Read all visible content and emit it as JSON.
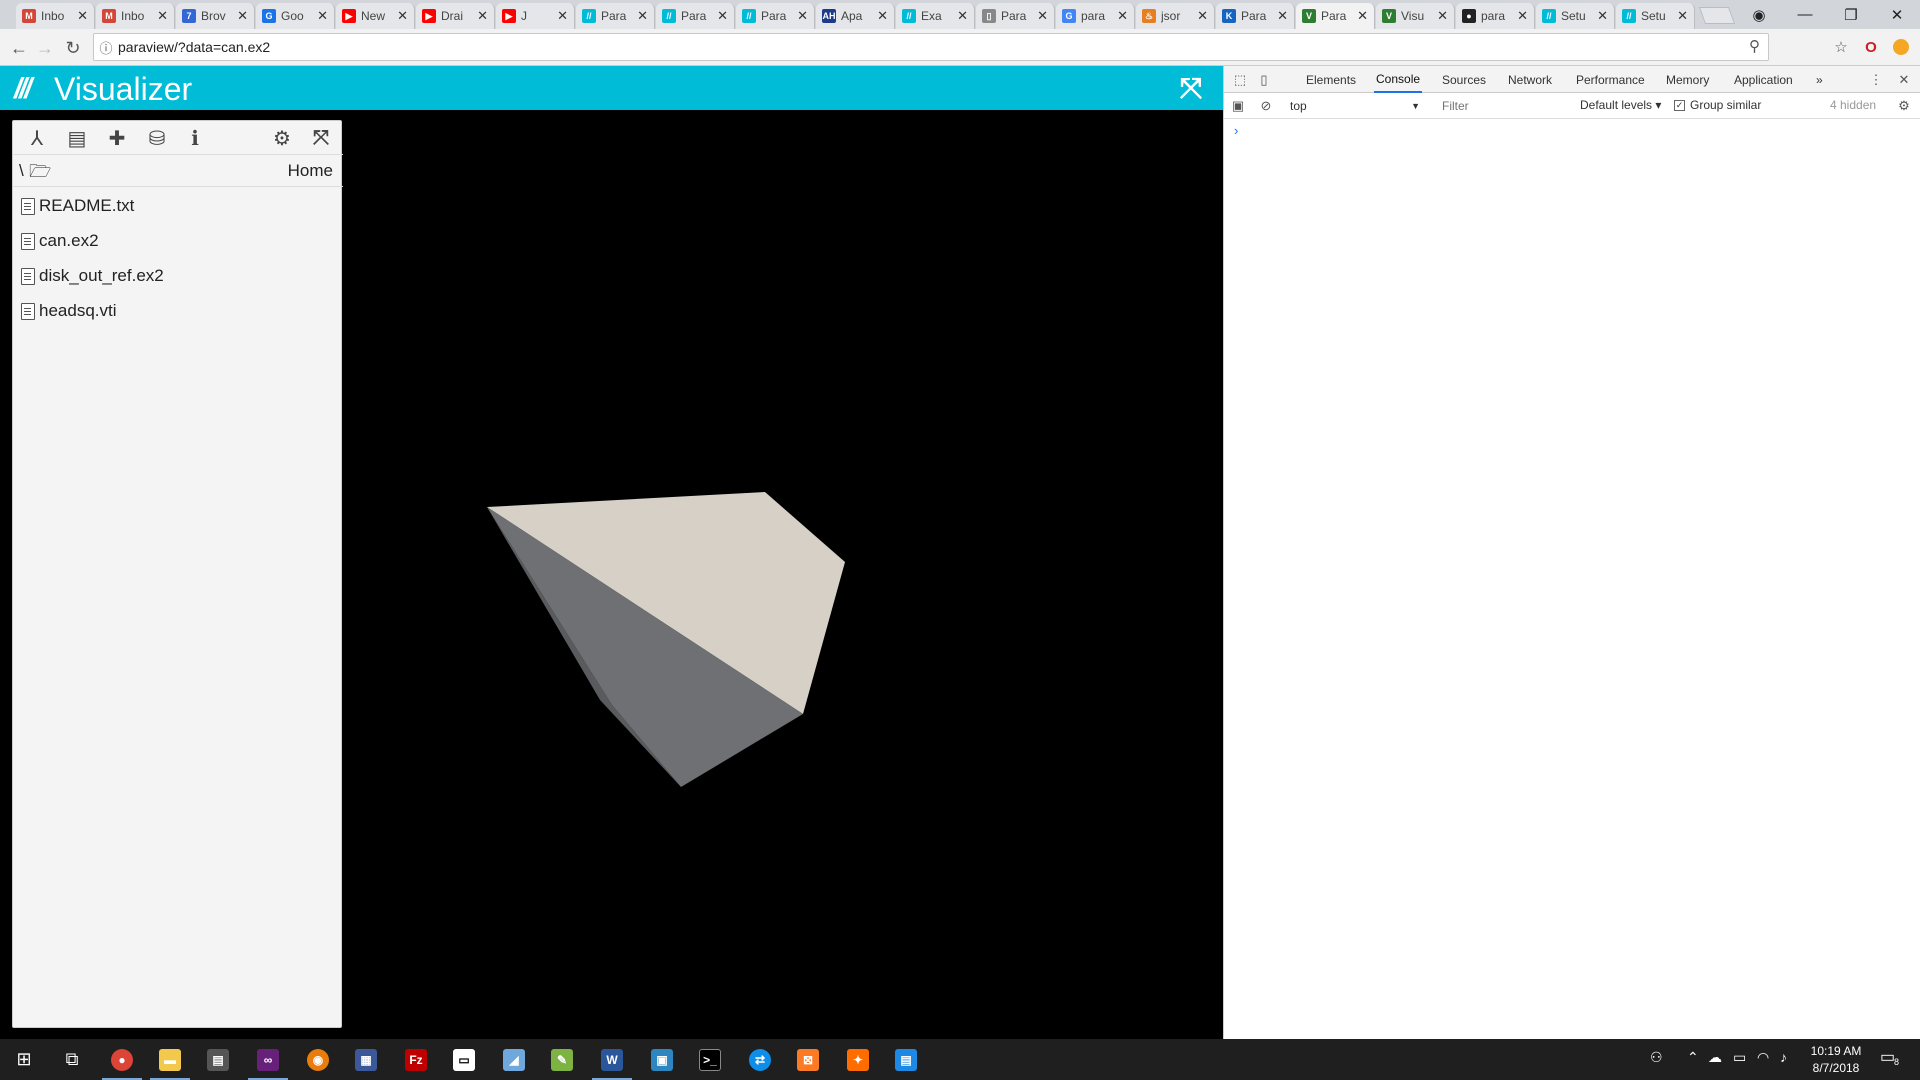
{
  "browser": {
    "tabs": [
      {
        "label": "Inbo",
        "fav": "M",
        "color": "#d44638"
      },
      {
        "label": "Inbo",
        "fav": "M",
        "color": "#d44638"
      },
      {
        "label": "Brov",
        "fav": "7",
        "color": "#3367d6"
      },
      {
        "label": "Goo",
        "fav": "G",
        "color": "#1a73e8"
      },
      {
        "label": "New",
        "fav": "▶",
        "color": "#ff0000"
      },
      {
        "label": "Drai",
        "fav": "▶",
        "color": "#ff0000"
      },
      {
        "label": "J",
        "fav": "▶",
        "color": "#ff0000"
      },
      {
        "label": "Para",
        "fav": "//",
        "color": "#00bcd7"
      },
      {
        "label": "Para",
        "fav": "//",
        "color": "#00bcd7"
      },
      {
        "label": "Para",
        "fav": "//",
        "color": "#00bcd7"
      },
      {
        "label": "Apa",
        "fav": "AH",
        "color": "#1e3a8a"
      },
      {
        "label": "Exa",
        "fav": "//",
        "color": "#00bcd7"
      },
      {
        "label": "Para",
        "fav": "▯",
        "color": "#888888"
      },
      {
        "label": "para",
        "fav": "G",
        "color": "#4285f4"
      },
      {
        "label": "jsor",
        "fav": "♨",
        "color": "#e67e22"
      },
      {
        "label": "Para",
        "fav": "K",
        "color": "#1565c0"
      },
      {
        "label": "Para",
        "fav": "V",
        "color": "#2e7d32"
      },
      {
        "label": "Visu",
        "fav": "V",
        "color": "#2e7d32"
      },
      {
        "label": "para",
        "fav": "●",
        "color": "#222222"
      },
      {
        "label": "Setu",
        "fav": "//",
        "color": "#00bcd7"
      },
      {
        "label": "Setu",
        "fav": "//",
        "color": "#00bcd7"
      }
    ],
    "url": "paraview/?data=can.ex2"
  },
  "app": {
    "title": "Visualizer",
    "logo": "///"
  },
  "panel": {
    "breadcrumb_sep": "\\",
    "breadcrumb_home": "Home",
    "files": [
      "README.txt",
      "can.ex2",
      "disk_out_ref.ex2",
      "headsq.vti"
    ]
  },
  "devtools": {
    "tabs": [
      "Elements",
      "Console",
      "Sources",
      "Network",
      "Performance",
      "Memory",
      "Application"
    ],
    "active_tab": "Console",
    "more": "»",
    "context": "top",
    "filter_placeholder": "Filter",
    "levels": "Default levels ▾",
    "group_similar": "Group similar",
    "hidden_count": "4 hidden",
    "prompt": "›"
  },
  "taskbar": {
    "time": "10:19 AM",
    "date": "8/7/2018",
    "notification_count": "8"
  },
  "colors": {
    "app_header": "#00bcd7",
    "devtools_accent": "#1a73e8"
  }
}
